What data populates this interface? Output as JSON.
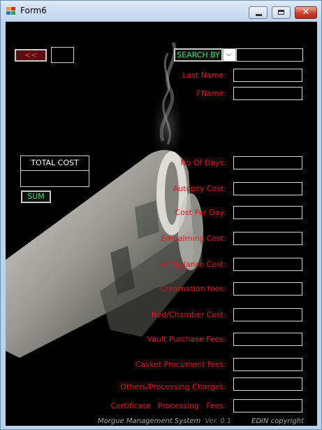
{
  "window": {
    "title": "Form6"
  },
  "nav": {
    "back_label": "<<"
  },
  "search": {
    "button_label": "SEARCH BY",
    "selected": "",
    "value": ""
  },
  "fields": {
    "last_name": {
      "label": "Last Name:",
      "value": ""
    },
    "fname": {
      "label": "FName:",
      "value": ""
    },
    "no_of_days": {
      "label": "No Of Days:",
      "value": ""
    },
    "autopsy_cost": {
      "label": "Autopsy Cost:",
      "value": ""
    },
    "cost_per_day": {
      "label": "Cost Per Day:",
      "value": ""
    },
    "embalming_cost": {
      "label": "Embalming Cost:",
      "value": ""
    },
    "ambulance_cost": {
      "label": "Ambulance Cost:",
      "value": ""
    },
    "creamation_fees": {
      "label": "Creamation fees:",
      "value": ""
    },
    "bed_chamber_cost": {
      "label": "Bed/Chamber Cost:",
      "value": ""
    },
    "vault_purchase_fees": {
      "label": "Vault Purchase Fees:",
      "value": ""
    },
    "casket_procument_fees": {
      "label": "Casket Procument fees:",
      "value": ""
    },
    "others_processing_charges": {
      "label": "Others/Processing Charges:",
      "value": ""
    },
    "certificate_processing_fees": {
      "label": "Certificate   Processing   Fees:",
      "value": ""
    }
  },
  "total": {
    "header": "TOTAL COST",
    "value": "",
    "sum_label": "SUM"
  },
  "footer": {
    "system": "Morgue Management System",
    "version": "Ver. 0.1",
    "copyright": "EDIN copyright"
  },
  "colors": {
    "label_red": "#e0141a",
    "button_green": "#34e26a",
    "back_red": "#d11a2a"
  }
}
